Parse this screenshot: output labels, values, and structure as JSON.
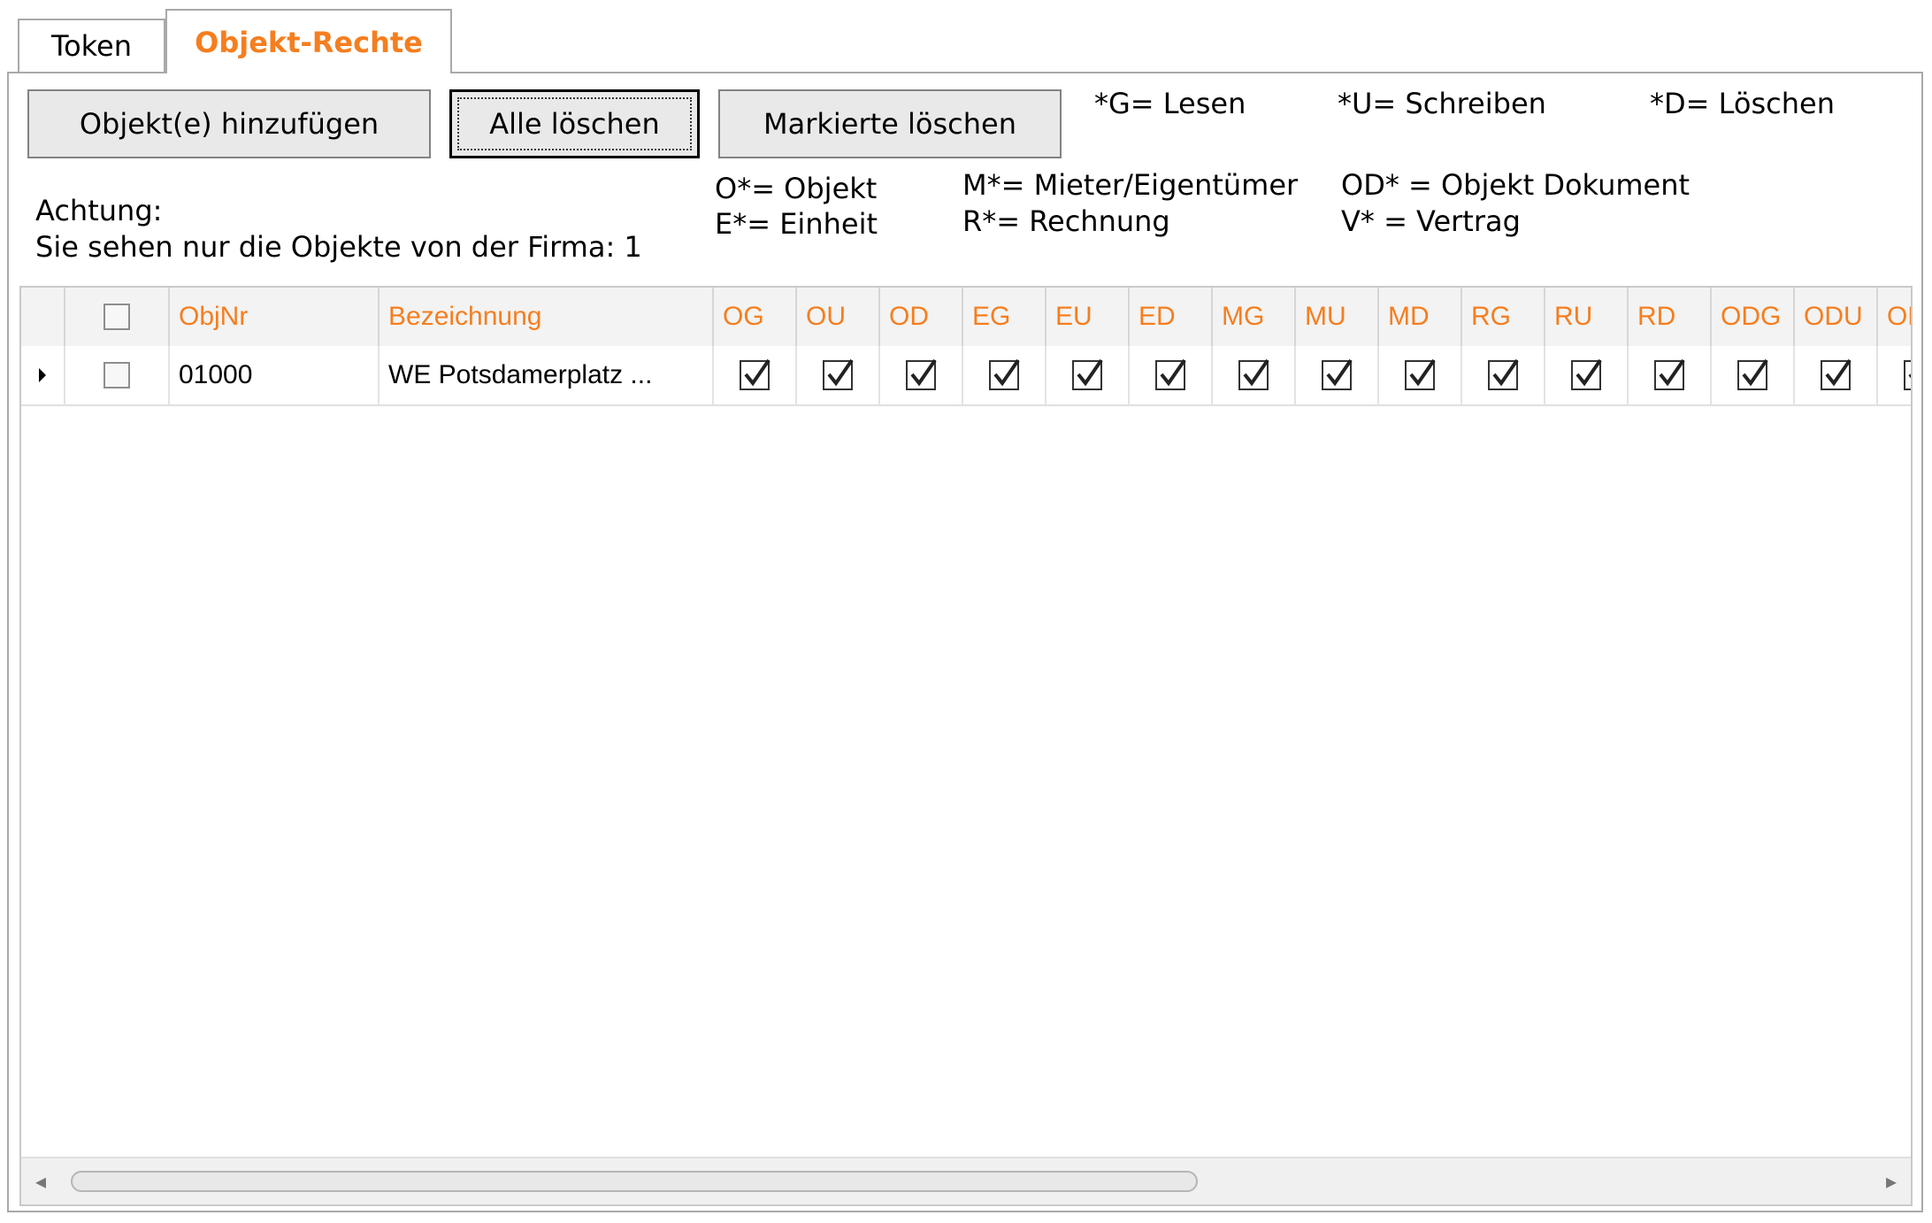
{
  "tabs": [
    {
      "label": "Token"
    },
    {
      "label": "Objekt-Rechte"
    }
  ],
  "toolbar": {
    "add_label": "Objekt(e) hinzufügen",
    "clear_all_label": "Alle löschen",
    "delete_marked_label": "Markierte löschen"
  },
  "legend": {
    "g": "*G=  Lesen",
    "u": "*U=  Schreiben",
    "d": "*D=  Löschen",
    "o": "O*= Objekt",
    "e": "E*= Einheit",
    "m": "M*= Mieter/Eigentümer",
    "r": "R*= Rechnung",
    "od": "OD* = Objekt Dokument",
    "v": "V* = Vertrag"
  },
  "notice": {
    "line1": "Achtung:",
    "line2": "Sie sehen nur die Objekte von der Firma: 1"
  },
  "grid": {
    "columns": [
      "ObjNr",
      "Bezeichnung",
      "OG",
      "OU",
      "OD",
      "EG",
      "EU",
      "ED",
      "MG",
      "MU",
      "MD",
      "RG",
      "RU",
      "RD",
      "ODG",
      "ODU",
      "OD"
    ],
    "rows": [
      {
        "selected": false,
        "objnr": "01000",
        "bezeichnung": "WE Potsdamerplatz ...",
        "rights": [
          true,
          true,
          true,
          true,
          true,
          true,
          true,
          true,
          true,
          true,
          true,
          true,
          true,
          true,
          true
        ]
      }
    ]
  },
  "colors": {
    "accent": "#f57e1f"
  }
}
